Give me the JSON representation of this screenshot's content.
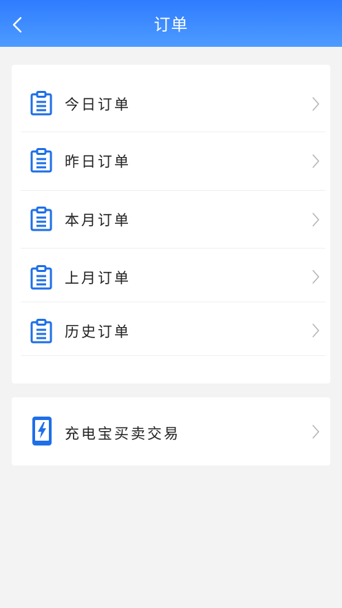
{
  "header": {
    "title": "订单",
    "back_icon": "chevron-left-icon"
  },
  "orders": {
    "items": [
      {
        "label": "今日订单",
        "icon": "clipboard-icon"
      },
      {
        "label": "昨日订单",
        "icon": "clipboard-icon"
      },
      {
        "label": "本月订单",
        "icon": "clipboard-icon"
      },
      {
        "label": "上月订单",
        "icon": "clipboard-icon"
      },
      {
        "label": "历史订单",
        "icon": "clipboard-icon"
      }
    ]
  },
  "trade": {
    "label": "充电宝买卖交易",
    "icon": "power-bank-icon"
  },
  "colors": {
    "accent": "#2f7cff",
    "icon_blue": "#1e6fe8",
    "background": "#f3f3f4"
  }
}
